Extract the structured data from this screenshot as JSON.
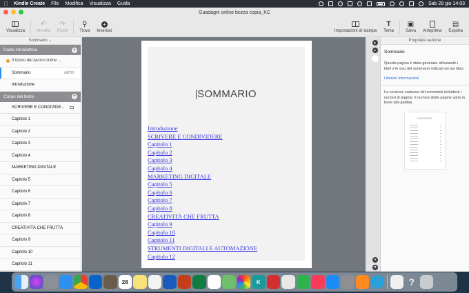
{
  "menubar": {
    "app_name": "Kindle Create",
    "menus": [
      "File",
      "Modifica",
      "Visualizza",
      "Guida"
    ],
    "clock": "Sab 28 giu  14:03"
  },
  "window": {
    "title": "Guadagni online bozza copia_KC"
  },
  "toolbar": {
    "visualizza": "Visualizza",
    "annulla": "Annulla",
    "ripeti": "Ripeti",
    "trova": "Trova",
    "inserisci": "Inserisci",
    "impostazioni_stampa": "Impostazioni di stampa",
    "tema": "Tema",
    "salva": "Salva",
    "anteprima": "Anteprima",
    "esporta": "Esporta"
  },
  "sidebar": {
    "header": "Sommario",
    "section_intro": "Parte introduttiva",
    "intro_items": [
      {
        "label": "Il futuro del lavoro online ..."
      },
      {
        "label": "Sommario",
        "tag": "AUTO"
      },
      {
        "label": "Introduzione"
      }
    ],
    "section_body": "Corpo del testo",
    "body_items": [
      "SCRIVERE E CONDIVIDE...",
      "Capitolo 1",
      "Capitolo 2",
      "Capitolo 3",
      "Capitolo 4",
      "MARKETING DIGITALE",
      "Capitolo 5",
      "Capitolo 6",
      "Capitolo 7",
      "Capitolo 8",
      "CREATIVITÀ CHE FRUTTA",
      "Capitolo 9",
      "Capitolo 10",
      "Capitolo 11"
    ]
  },
  "page": {
    "title": "SOMMARIO",
    "toc": [
      "Introduzione",
      "SCRIVERE E CONDIVIDERE",
      "Capitolo 1",
      "Capitolo 2",
      "Capitolo 3",
      "Capitolo 4",
      "MARKETING DIGITALE",
      "Capitolo 5",
      "Capitolo 6",
      "Capitolo 7",
      "Capitolo 8",
      "CREATIVITÀ CHE FRUTTA",
      "Capitolo 9",
      "Capitolo 10",
      "Capitolo 11",
      "STRUMENTI DIGITALI E AUTOMAZIONE",
      "Capitolo 12"
    ]
  },
  "properties": {
    "header": "Proprietà sezione",
    "title": "Sommario",
    "description": "Questa pagina è stata generata utilizzando i titoli o le voci del sommario indicati nel tuo libro.",
    "link": "Ulteriori informazioni",
    "print_note": "La versione cartacea del sommario includerà i numeri di pagina. Il numero delle pagine varia in base alla gabbia.",
    "thumb_title": "CONTENTS"
  },
  "dock": {
    "icons": [
      "finder",
      "siri",
      "launchpad",
      "safari",
      "chrome",
      "outlook",
      "scanner",
      "calendar",
      "notes",
      "freeform",
      "word",
      "powerpoint",
      "excel",
      "reminders",
      "maps",
      "photos",
      "kindle-create",
      "acrobat",
      "pdf",
      "numbers",
      "music",
      "appstore",
      "settings",
      "books",
      "kindle",
      "preview",
      "help",
      "trash"
    ],
    "calendar_day": "28",
    "colors": {
      "accent": "#2d8cf0",
      "section": "#8e8e92",
      "link": "#3a3ae0"
    }
  }
}
